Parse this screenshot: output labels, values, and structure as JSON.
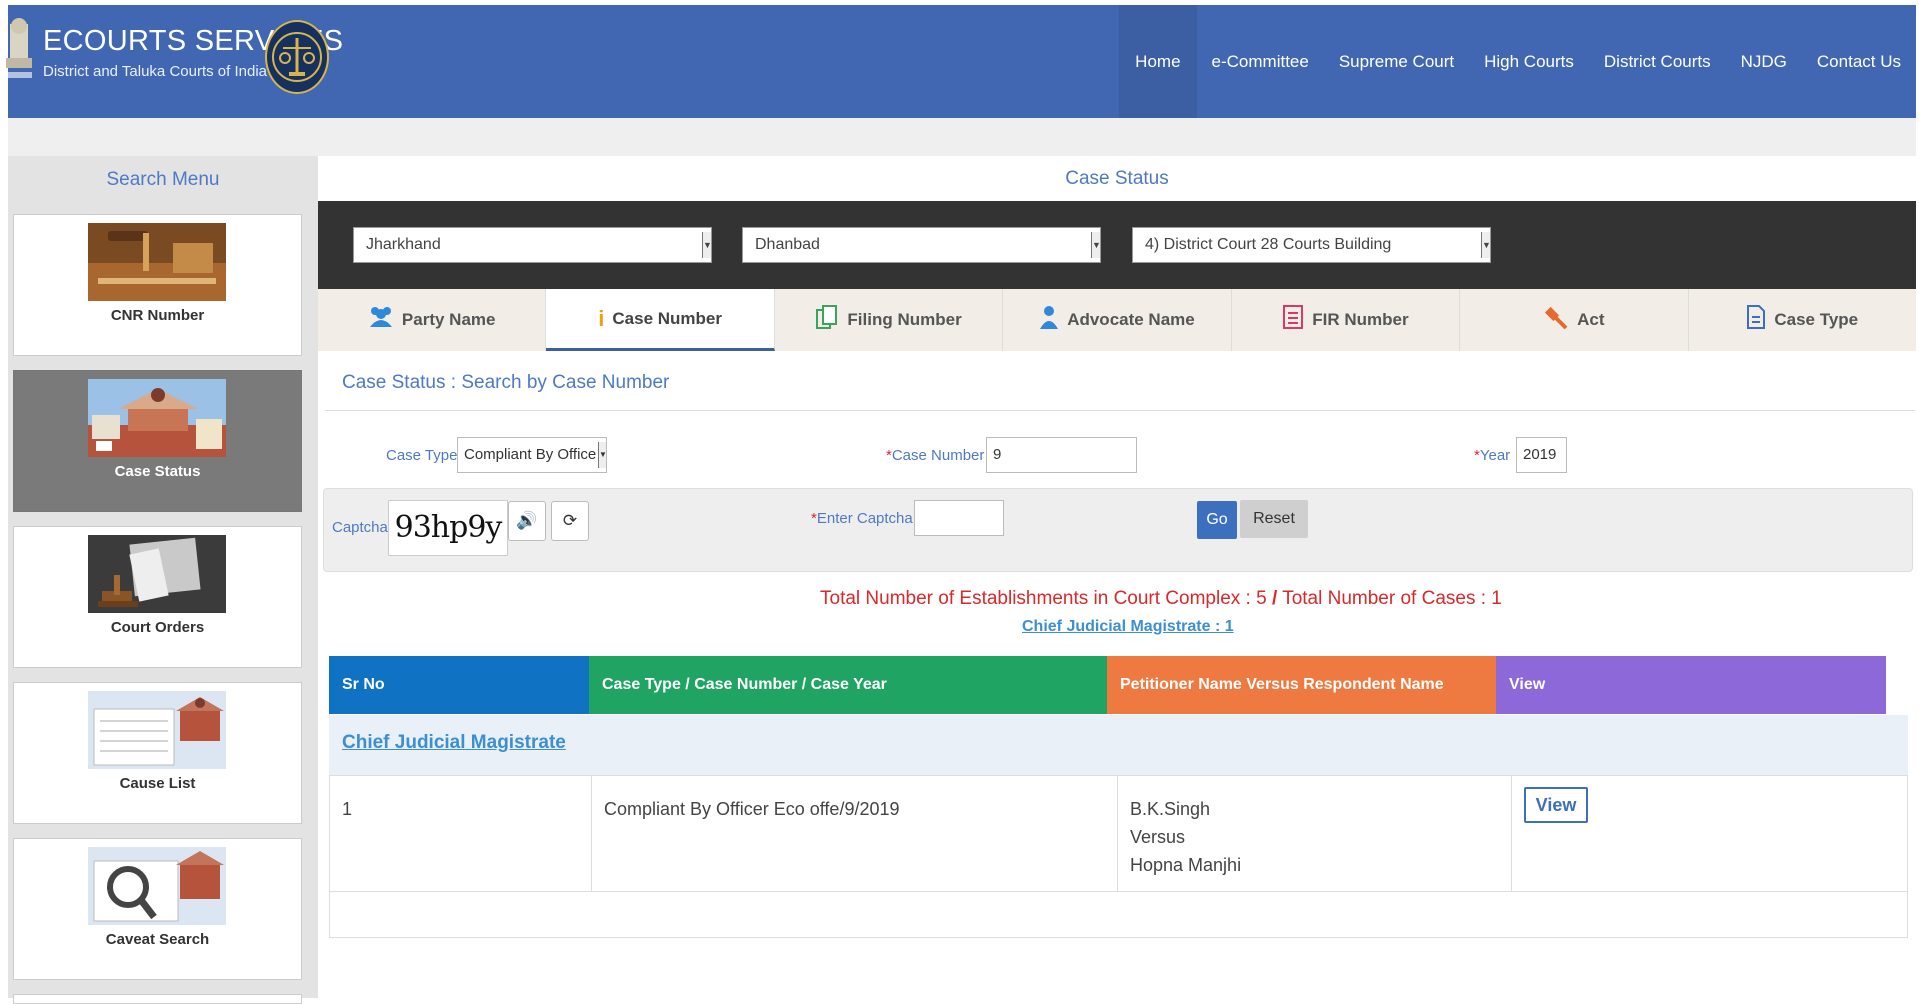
{
  "header": {
    "title": "ECOURTS SERVICES",
    "subtitle": "District and Taluka Courts of India",
    "nav": [
      "Home",
      "e-Committee",
      "Supreme Court",
      "High Courts",
      "District Courts",
      "NJDG",
      "Contact Us"
    ],
    "color": "#4267b2"
  },
  "sidebar": {
    "title": "Search Menu",
    "items": [
      {
        "label": "CNR Number",
        "icon": "gavel-courtroom-image"
      },
      {
        "label": "Case Status",
        "icon": "supreme-court-building-image",
        "active": true
      },
      {
        "label": "Court Orders",
        "icon": "documents-gavel-image"
      },
      {
        "label": "Cause List",
        "icon": "cause-list-document-image"
      },
      {
        "label": "Caveat Search",
        "icon": "magnifier-document-image"
      }
    ]
  },
  "main": {
    "title": "Case Status",
    "selects": {
      "state": "Jharkhand",
      "district": "Dhanbad",
      "complex": "4) District Court 28 Courts Building"
    },
    "tabs": [
      {
        "label": "Party Name",
        "icon": "people-icon"
      },
      {
        "label": "Case Number",
        "icon": "info-icon",
        "active": true
      },
      {
        "label": "Filing Number",
        "icon": "files-icon"
      },
      {
        "label": "Advocate Name",
        "icon": "user-icon"
      },
      {
        "label": "FIR Number",
        "icon": "list-doc-icon"
      },
      {
        "label": "Act",
        "icon": "gavel-icon"
      },
      {
        "label": "Case Type",
        "icon": "file-text-icon"
      }
    ],
    "section_title": "Case Status : Search by Case Number",
    "form": {
      "case_type_label": "Case Type",
      "case_type_value": "Compliant By Office",
      "star": "*",
      "case_number_label": "Case Number",
      "case_number_value": "9",
      "year_label": "Year",
      "year_value": "2019",
      "captcha_label": "Captcha",
      "captcha_text": "93hp9y",
      "enter_captcha_label": "Enter Captcha",
      "enter_captcha_value": "",
      "go": "Go",
      "reset": "Reset"
    },
    "summary": {
      "establishments_label": "Total Number of Establishments in Court Complex :",
      "establishments": "5",
      "sep": "/",
      "cases_label": "Total Number of Cases :",
      "cases": "1",
      "court_link": "Chief Judicial Magistrate : 1"
    },
    "table": {
      "headers": [
        "Sr No",
        "Case Type / Case Number / Case Year",
        "Petitioner Name Versus Respondent Name",
        "View"
      ],
      "header_colors": [
        "#0f72c2",
        "#1fa463",
        "#ef7a41",
        "#8c68d8"
      ],
      "group": "Chief Judicial Magistrate",
      "rows": [
        {
          "sr": "1",
          "case": "Compliant By Officer Eco offe/9/2019",
          "petitioner": "B.K.Singh",
          "versus": "Versus",
          "respondent": "Hopna Manjhi",
          "view": "View"
        }
      ]
    }
  }
}
